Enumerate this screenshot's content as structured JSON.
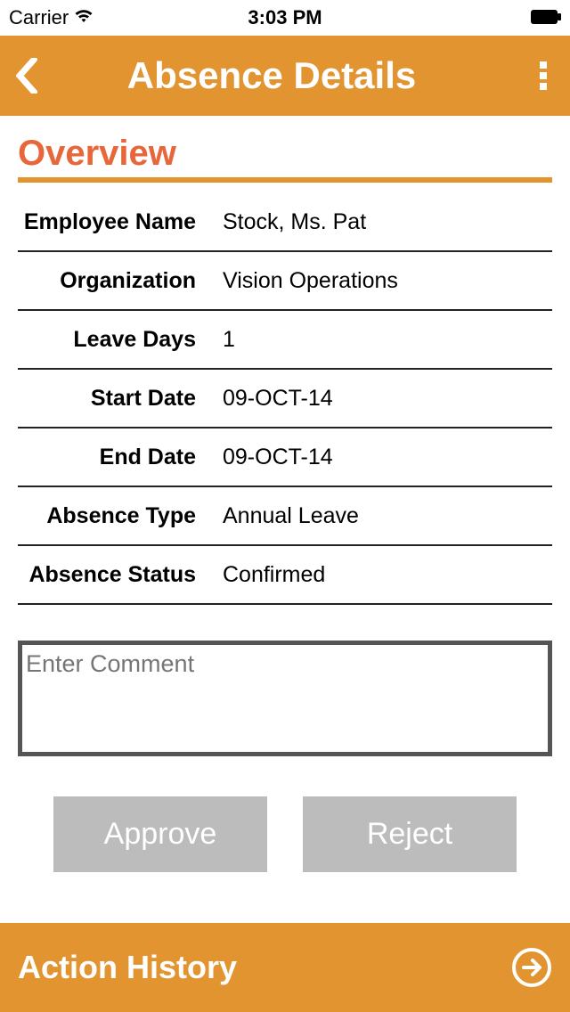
{
  "status_bar": {
    "carrier": "Carrier",
    "time": "3:03 PM"
  },
  "header": {
    "title": "Absence Details"
  },
  "section_title": "Overview",
  "fields": [
    {
      "label": "Employee Name",
      "value": "Stock, Ms. Pat"
    },
    {
      "label": "Organization",
      "value": "Vision Operations"
    },
    {
      "label": "Leave Days",
      "value": "1"
    },
    {
      "label": "Start Date",
      "value": "09-OCT-14"
    },
    {
      "label": "End Date",
      "value": "09-OCT-14"
    },
    {
      "label": "Absence Type",
      "value": "Annual Leave"
    },
    {
      "label": "Absence Status",
      "value": "Confirmed"
    }
  ],
  "comment": {
    "placeholder": "Enter Comment",
    "value": ""
  },
  "buttons": {
    "approve": "Approve",
    "reject": "Reject"
  },
  "footer": {
    "label": "Action History"
  }
}
